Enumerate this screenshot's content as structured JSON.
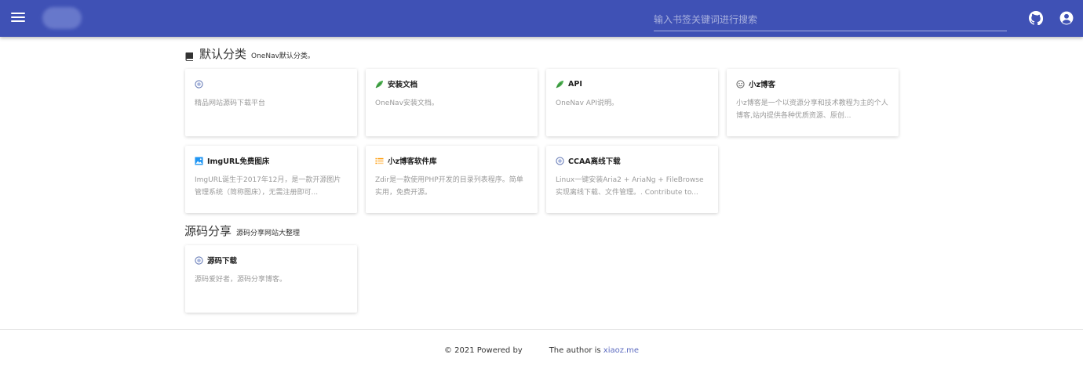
{
  "header": {
    "search_placeholder": "输入书签关键词进行搜索",
    "bg_color": "#3f51b5",
    "icons": [
      "menu-icon",
      "github-icon",
      "user-icon"
    ]
  },
  "sections": [
    {
      "title": "默认分类",
      "subtitle": "OneNav默认分类。",
      "icon": "book-icon",
      "cards": [
        {
          "name": "",
          "desc": "精品网站源码下载平台",
          "icon": "globe-icon"
        },
        {
          "name": "安装文档",
          "desc": "OneNav安装文档。",
          "icon": "leaf-icon"
        },
        {
          "name": "API",
          "desc": "OneNav API说明。",
          "icon": "leaf-icon"
        },
        {
          "name": "小z博客",
          "desc": "小z博客是一个以资源分享和技术教程为主的个人博客,站内提供各种优质资源、原创...",
          "icon": "smile-icon"
        },
        {
          "name": "ImgURL免费图床",
          "desc": "ImgURL诞生于2017年12月，是一款开源图片管理系统（简称图床），无需注册即可...",
          "icon": "image-icon"
        },
        {
          "name": "小z博客软件库",
          "desc": "Zdir是一款使用PHP开发的目录列表程序。简单实用，免费开源。",
          "icon": "list-icon"
        },
        {
          "name": "CCAA离线下载",
          "desc": "Linux一键安装Aria2 + AriaNg + FileBrowse实现离线下载、文件管理。. Contribute to...",
          "icon": "globe-icon"
        }
      ]
    },
    {
      "title": "源码分享",
      "subtitle": "源码分享网站大整理",
      "cards": [
        {
          "name": "源码下载",
          "desc": "源码爱好者，源码分享博客。",
          "icon": "globe-icon"
        }
      ]
    }
  ],
  "footer": {
    "prefix": "© 2021 Powered by",
    "author_text": "The author is",
    "author_link": "xiaoz.me",
    "link_color": "#5c6bc0"
  }
}
